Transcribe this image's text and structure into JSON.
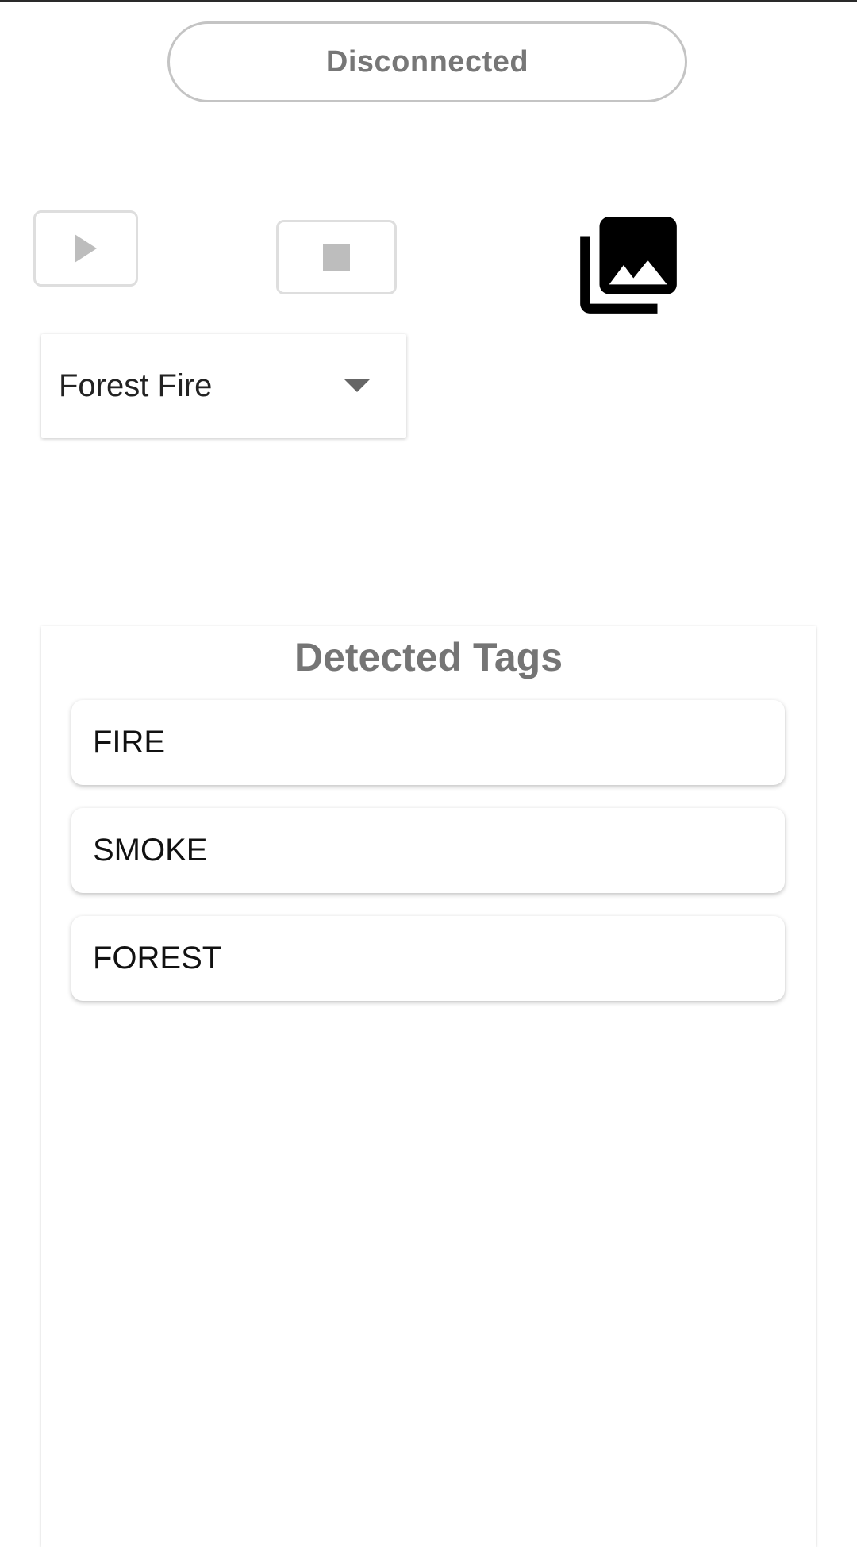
{
  "status": {
    "label": "Disconnected"
  },
  "controls": {
    "play_icon": "play-icon",
    "stop_icon": "stop-icon",
    "gallery_icon": "photo-library-icon"
  },
  "scene_select": {
    "selected": "Forest Fire",
    "caret_icon": "caret-down-icon"
  },
  "detected_tags": {
    "title": "Detected Tags",
    "items": [
      {
        "label": "FIRE"
      },
      {
        "label": "SMOKE"
      },
      {
        "label": "FOREST"
      }
    ]
  },
  "colors": {
    "disabled_gray": "#c4c4c4",
    "title_gray": "#757575",
    "icon_black": "#000000"
  }
}
